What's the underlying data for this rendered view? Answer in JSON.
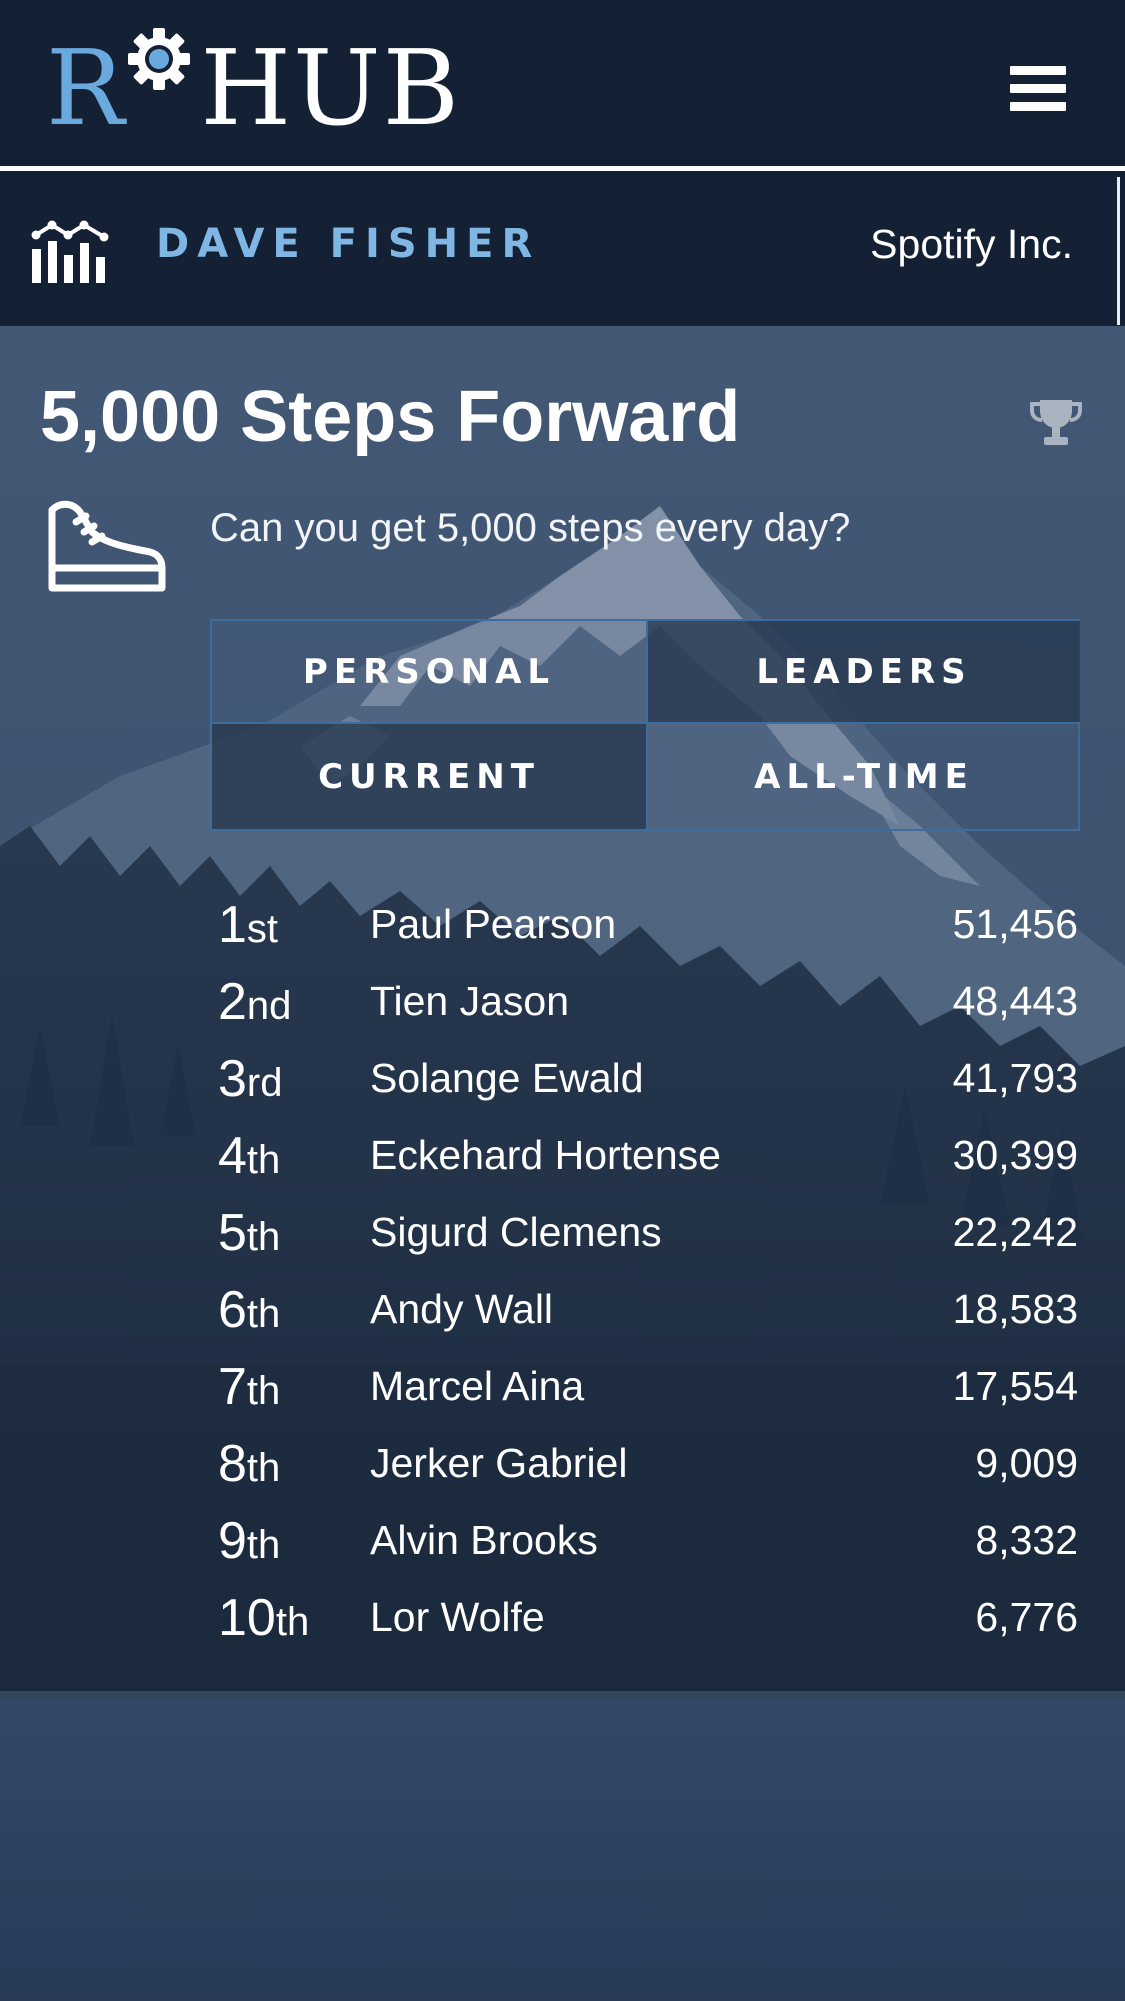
{
  "header": {
    "logo_r": "R",
    "logo_hub": "HUB",
    "menu_icon": "hamburger-menu-icon"
  },
  "user": {
    "name": "DAVE FISHER",
    "company": "Spotify Inc.",
    "icon": "stats-chart-icon"
  },
  "challenge": {
    "title": "5,000 Steps Forward",
    "description": "Can you get 5,000 steps every day?",
    "icon": "sneaker-icon",
    "trophy_icon": "trophy-icon"
  },
  "toggles": {
    "personal": "PERSONAL",
    "leaders": "LEADERS",
    "current": "CURRENT",
    "all_time": "ALL-TIME",
    "active": [
      "leaders",
      "current"
    ]
  },
  "leaderboard": [
    {
      "rank": "1",
      "suffix": "st",
      "name": "Paul Pearson",
      "score": "51,456"
    },
    {
      "rank": "2",
      "suffix": "nd",
      "name": "Tien Jason",
      "score": "48,443"
    },
    {
      "rank": "3",
      "suffix": "rd",
      "name": "Solange Ewald",
      "score": "41,793"
    },
    {
      "rank": "4",
      "suffix": "th",
      "name": "Eckehard Hortense",
      "score": "30,399"
    },
    {
      "rank": "5",
      "suffix": "th",
      "name": "Sigurd Clemens",
      "score": "22,242"
    },
    {
      "rank": "6",
      "suffix": "th",
      "name": "Andy Wall",
      "score": "18,583"
    },
    {
      "rank": "7",
      "suffix": "th",
      "name": "Marcel Aina",
      "score": "17,554"
    },
    {
      "rank": "8",
      "suffix": "th",
      "name": "Jerker Gabriel",
      "score": "9,009"
    },
    {
      "rank": "9",
      "suffix": "th",
      "name": "Alvin Brooks",
      "score": "8,332"
    },
    {
      "rank": "10",
      "suffix": "th",
      "name": "Lor Wolfe",
      "score": "6,776"
    }
  ],
  "colors": {
    "navy": "#142033",
    "accent_blue": "#6aa9de",
    "name_blue": "#7fb6e4",
    "border_blue": "#3e6c9c"
  }
}
